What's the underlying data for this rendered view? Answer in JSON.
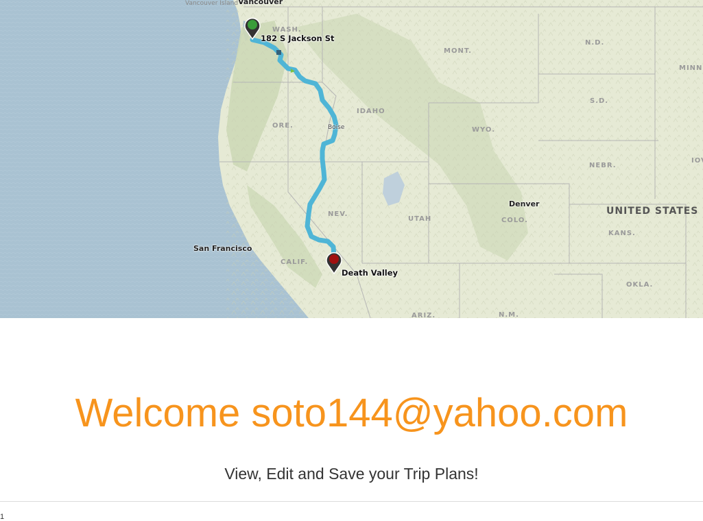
{
  "map": {
    "labels": {
      "vancouver_island": "Vancouver Island",
      "vancouver": "Vancouver",
      "wash": "WASH.",
      "mont": "MONT.",
      "nd": "N.D.",
      "minn": "MINN",
      "sd": "S.D.",
      "idaho": "IDAHO",
      "ore": "ORE.",
      "boise": "Boise",
      "wyo": "WYO.",
      "iowa": "IOV",
      "nebr": "NEBR.",
      "nev": "NEV.",
      "utah": "UTAH",
      "colo": "COLO.",
      "denver": "Denver",
      "united_states": "UNITED STATES",
      "kans": "KANS.",
      "san_francisco": "San Francisco",
      "calif": "CALIF.",
      "okla": "OKLA.",
      "ariz": "ARIZ.",
      "nm": "N.M."
    },
    "start": {
      "label": "182 S Jackson St",
      "color": "#3a9d3a"
    },
    "end": {
      "label": "Death Valley",
      "color": "#a01010"
    },
    "route_color": "#4fb5d6",
    "ocean_color": "#a9c2d2",
    "land_color": "#e6ead5"
  },
  "welcome": "Welcome soto144@yahoo.com",
  "subtitle": "View, Edit and Save your Trip Plans!",
  "footer_number": "1"
}
